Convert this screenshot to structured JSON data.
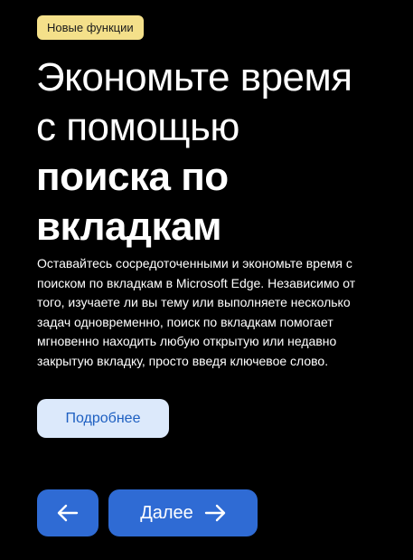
{
  "badge": "Новые функции",
  "heading": {
    "line1": "Экономьте время",
    "line2": "с помощью",
    "line3": "поиска по",
    "line4": "вкладкам"
  },
  "description": "Оставайтесь сосредоточенными и экономьте время с поиском по вкладкам в Microsoft Edge. Независимо от того, изучаете ли вы тему или выполняете несколько задач одновременно, поиск по вкладкам помогает мгновенно находить любую открытую или недавно закрытую вкладку, просто введя ключевое слово.",
  "buttons": {
    "more_label": "Подробнее",
    "back_icon": "arrow-left-icon",
    "next_label": "Далее",
    "next_icon": "arrow-right-icon"
  },
  "colors": {
    "background": "#000000",
    "badge_bg": "#f4e08a",
    "primary_button": "#2f6bd4",
    "secondary_button_bg": "#dce9fb",
    "secondary_button_text": "#1d5fc1"
  }
}
